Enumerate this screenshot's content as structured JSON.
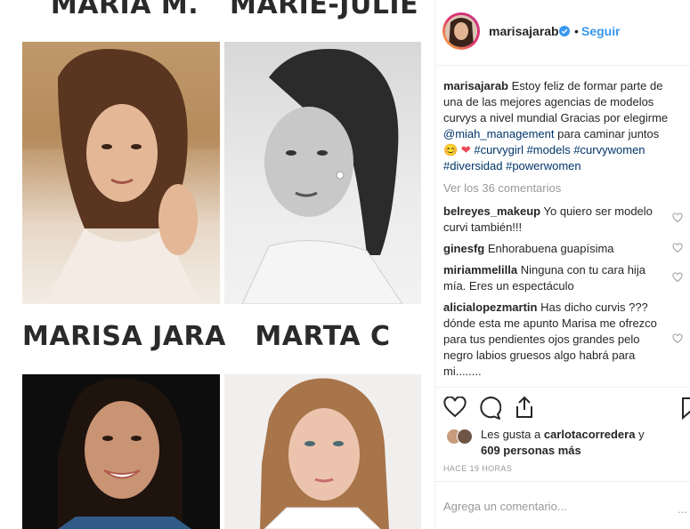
{
  "post": {
    "top_names": [
      "MARIA M.",
      "MARIE-JULIE"
    ],
    "middle_names": [
      "MARISA JARA",
      "MARTA C"
    ]
  },
  "header": {
    "username": "marisajarab",
    "dot": "•",
    "follow_label": "Seguir"
  },
  "caption": {
    "username": "marisajarab",
    "text1": "Estoy feliz de formar parte de una de las mejores agencias de modelos curvys a nivel mundial Gracias por elegirme",
    "mention": "@miah_management",
    "text2": "para caminar juntos",
    "emoji1": "😊",
    "emoji2": "❤",
    "hashtags1": "#curvygirl #models #curvywomen",
    "hashtags2": "#diversidad #powerwomen"
  },
  "view_all": "Ver los 36 comentarios",
  "comments": [
    {
      "user": "belreyes_makeup",
      "text": "Yo quiero ser modelo curvi también!!!"
    },
    {
      "user": "ginesfg",
      "text": "Enhorabuena guapísima"
    },
    {
      "user": "miriammelilla",
      "text": "Ninguna con tu cara hija mía. Eres un espectáculo"
    },
    {
      "user": "alicialopezmartin",
      "text": "Has dicho curvis ??? dónde esta me apunto Marisa me ofrezco para tus pendientes ojos grandes pelo negro labios gruesos algo habrá para mi........"
    }
  ],
  "likes": {
    "prefix": "Les gusta a",
    "liker": "carlotacorredera",
    "suffix": "y",
    "count": "609 personas más"
  },
  "timestamp": "HACE 19 HORAS",
  "add_comment_placeholder": "Agrega un comentario...",
  "more_label": "...",
  "icons": [
    "heart-icon",
    "comment-icon",
    "share-icon",
    "bookmark-icon",
    "verified-icon"
  ],
  "colors": {
    "link": "#3897f0",
    "mention": "#003569",
    "heart": "#ed4956"
  }
}
